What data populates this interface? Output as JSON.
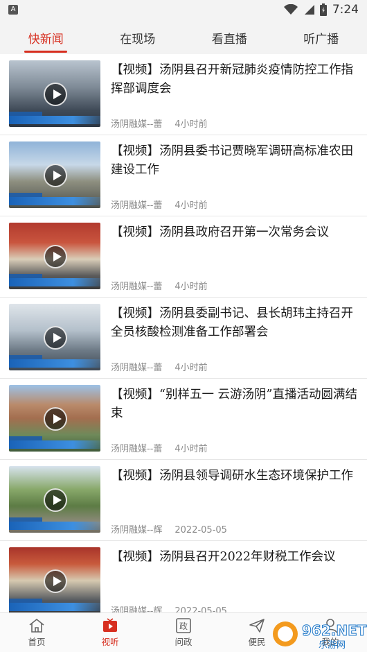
{
  "status_bar": {
    "left_badge": "A",
    "time": "7:24",
    "icons": [
      "wifi-icon",
      "cellular-icon",
      "battery-icon"
    ]
  },
  "tabs": [
    {
      "label": "快新闻",
      "active": true
    },
    {
      "label": "在现场",
      "active": false
    },
    {
      "label": "看直播",
      "active": false
    },
    {
      "label": "听广播",
      "active": false
    }
  ],
  "news": [
    {
      "title": "【视频】汤阴县召开新冠肺炎疫情防控工作指挥部调度会",
      "source": "汤阴融媒--蕾",
      "time": "4小时前"
    },
    {
      "title": "【视频】汤阴县委书记贾晓军调研高标准农田建设工作",
      "source": "汤阴融媒--蕾",
      "time": "4小时前"
    },
    {
      "title": "【视频】汤阴县政府召开第一次常务会议",
      "source": "汤阴融媒--蕾",
      "time": "4小时前"
    },
    {
      "title": "【视频】汤阴县委副书记、县长胡玮主持召开全员核酸检测准备工作部署会",
      "source": "汤阴融媒--蕾",
      "time": "4小时前"
    },
    {
      "title": "【视频】“别样五一 云游汤阴”直播活动圆满结束",
      "source": "汤阴融媒--蕾",
      "time": "4小时前"
    },
    {
      "title": "【视频】汤阴县领导调研水生态环境保护工作",
      "source": "汤阴融媒--辉",
      "time": "2022-05-05"
    },
    {
      "title": "【视频】汤阴县召开2022年财税工作会议",
      "source": "汤阴融媒--辉",
      "time": "2022-05-05"
    }
  ],
  "bottom_nav": [
    {
      "label": "首页",
      "icon": "home-icon",
      "active": false
    },
    {
      "label": "视听",
      "icon": "tv-icon",
      "active": true
    },
    {
      "label": "问政",
      "icon": "government-icon",
      "active": false
    },
    {
      "label": "便民",
      "icon": "send-icon",
      "active": false
    },
    {
      "label": "我的",
      "icon": "user-icon",
      "active": false
    }
  ],
  "watermark": {
    "text": "962.NET",
    "subtext": "乐游网"
  },
  "colors": {
    "accent": "#d72f20",
    "video_bar": "#1a63b8"
  }
}
